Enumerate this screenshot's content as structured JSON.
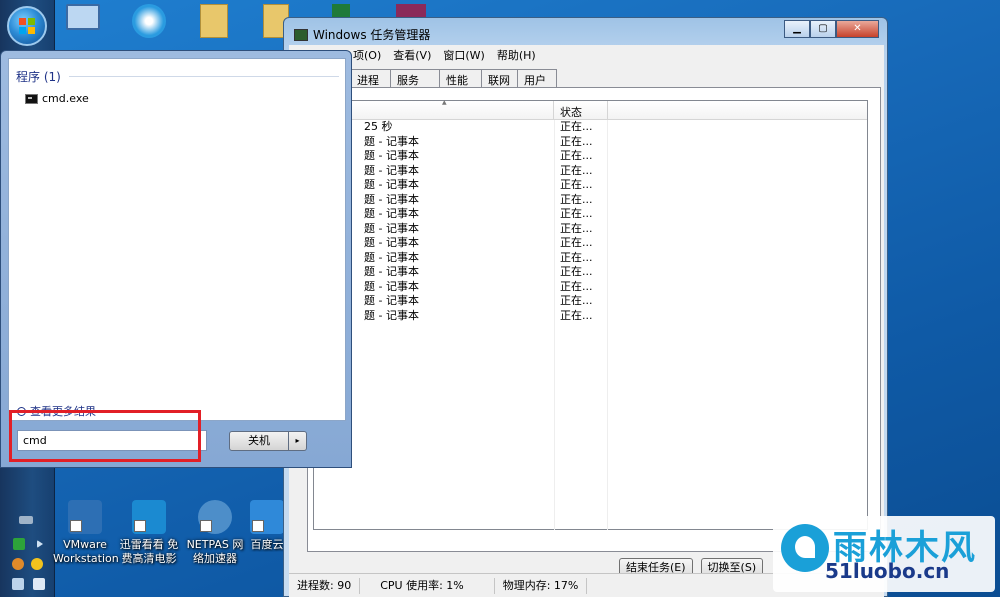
{
  "colors": {
    "accent": "#1e3287",
    "highlight": "#e21f26",
    "watermark": "#1aa0d8"
  },
  "task_manager": {
    "title": "Windows 任务管理器",
    "menu": [
      "项(O)",
      "查看(V)",
      "窗口(W)",
      "帮助(H)"
    ],
    "tabs": [
      "进程",
      "服务",
      "性能",
      "联网",
      "用户"
    ],
    "status_col_header": "状态",
    "rows": [
      {
        "task": "25 秒",
        "status": "正在..."
      },
      {
        "task": "题 - 记事本",
        "status": "正在..."
      },
      {
        "task": "题 - 记事本",
        "status": "正在..."
      },
      {
        "task": "题 - 记事本",
        "status": "正在..."
      },
      {
        "task": "题 - 记事本",
        "status": "正在..."
      },
      {
        "task": "题 - 记事本",
        "status": "正在..."
      },
      {
        "task": "题 - 记事本",
        "status": "正在..."
      },
      {
        "task": "题 - 记事本",
        "status": "正在..."
      },
      {
        "task": "题 - 记事本",
        "status": "正在..."
      },
      {
        "task": "题 - 记事本",
        "status": "正在..."
      },
      {
        "task": "题 - 记事本",
        "status": "正在..."
      },
      {
        "task": "题 - 记事本",
        "status": "正在..."
      },
      {
        "task": "题 - 记事本",
        "status": "正在..."
      },
      {
        "task": "题 - 记事本",
        "status": "正在..."
      }
    ],
    "end_task_label": "结束任务(E)",
    "switch_to_label": "切换至(S)",
    "status_bar": {
      "processes": "进程数: 90",
      "cpu": "CPU 使用率: 1%",
      "memory": "物理内存: 17%"
    }
  },
  "start_menu": {
    "section_heading": "程序 (1)",
    "result_item": "cmd.exe",
    "see_more": "查看更多结果",
    "search_value": "cmd",
    "shutdown_label": "关机",
    "shutdown_arrow": "▸"
  },
  "desktop_icons": [
    {
      "label": "VMware Workstation",
      "color": "#2d6fb4"
    },
    {
      "label": "迅雷看看 免费高清电影",
      "color": "#1b8ad1"
    },
    {
      "label": "NETPAS 网络加速器",
      "color": "#4d8ec9"
    },
    {
      "label": "百度云",
      "color": "#2f89d9"
    }
  ],
  "watermark": {
    "line1": "雨林木风",
    "line2": "51luobo.cn"
  }
}
